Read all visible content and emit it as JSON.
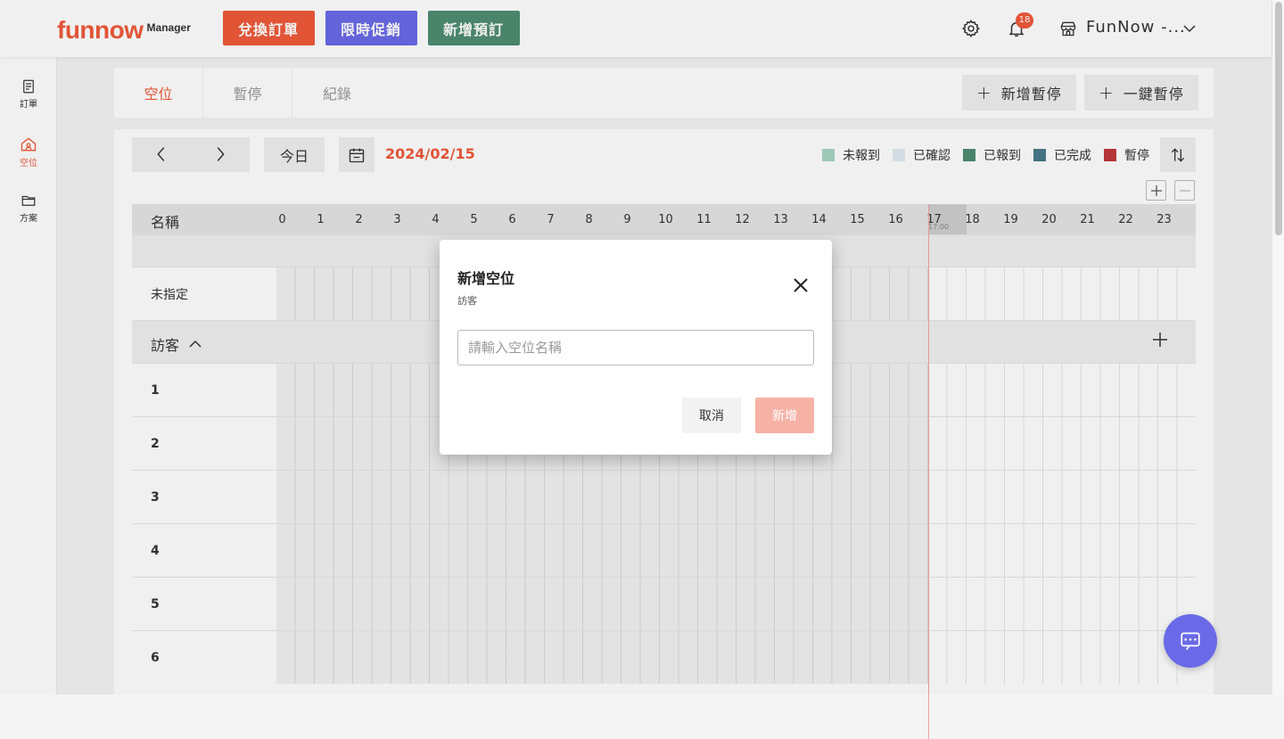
{
  "brand": {
    "logo_main": "funnow",
    "logo_sub": "Manager"
  },
  "topbar": {
    "buttons": [
      {
        "label": "兌換訂單",
        "color": "#f05a3a"
      },
      {
        "label": "限時促銷",
        "color": "#6a6ae8"
      },
      {
        "label": "新增預訂",
        "color": "#4e8d72"
      }
    ],
    "notification_count": "18",
    "store_name": "FunNow -..."
  },
  "sidenav": [
    {
      "label": "訂單",
      "icon": "document-icon"
    },
    {
      "label": "空位",
      "icon": "home-icon",
      "active": true
    },
    {
      "label": "方案",
      "icon": "folder-icon"
    }
  ],
  "tabs": [
    {
      "label": "空位",
      "active": true
    },
    {
      "label": "暫停"
    },
    {
      "label": "紀錄"
    }
  ],
  "actions": {
    "add_pause": "新增暫停",
    "one_click_pause": "一鍵暫停"
  },
  "toolbar": {
    "today": "今日",
    "date": "2024/02/15"
  },
  "legend": [
    {
      "label": "未報到",
      "color": "#a9d5c4"
    },
    {
      "label": "已確認",
      "color": "#e0ebf2"
    },
    {
      "label": "已報到",
      "color": "#4e8d72"
    },
    {
      "label": "已完成",
      "color": "#4a7a8c"
    },
    {
      "label": "暫停",
      "color": "#c0393b"
    }
  ],
  "grid": {
    "name_header": "名稱",
    "hours": [
      "0",
      "1",
      "2",
      "3",
      "4",
      "5",
      "6",
      "7",
      "8",
      "9",
      "10",
      "11",
      "12",
      "13",
      "14",
      "15",
      "16",
      "17",
      "18",
      "19",
      "20",
      "21",
      "22",
      "23"
    ],
    "current_hour": "17",
    "current_time_label": "17:00",
    "unassigned_label": "未指定",
    "group_label": "訪客",
    "rows": [
      "1",
      "2",
      "3",
      "4",
      "5",
      "6"
    ]
  },
  "modal": {
    "title": "新增空位",
    "subtitle": "訪客",
    "input_placeholder": "請輸入空位名稱",
    "input_value": "",
    "cancel_label": "取消",
    "submit_label": "新增"
  }
}
